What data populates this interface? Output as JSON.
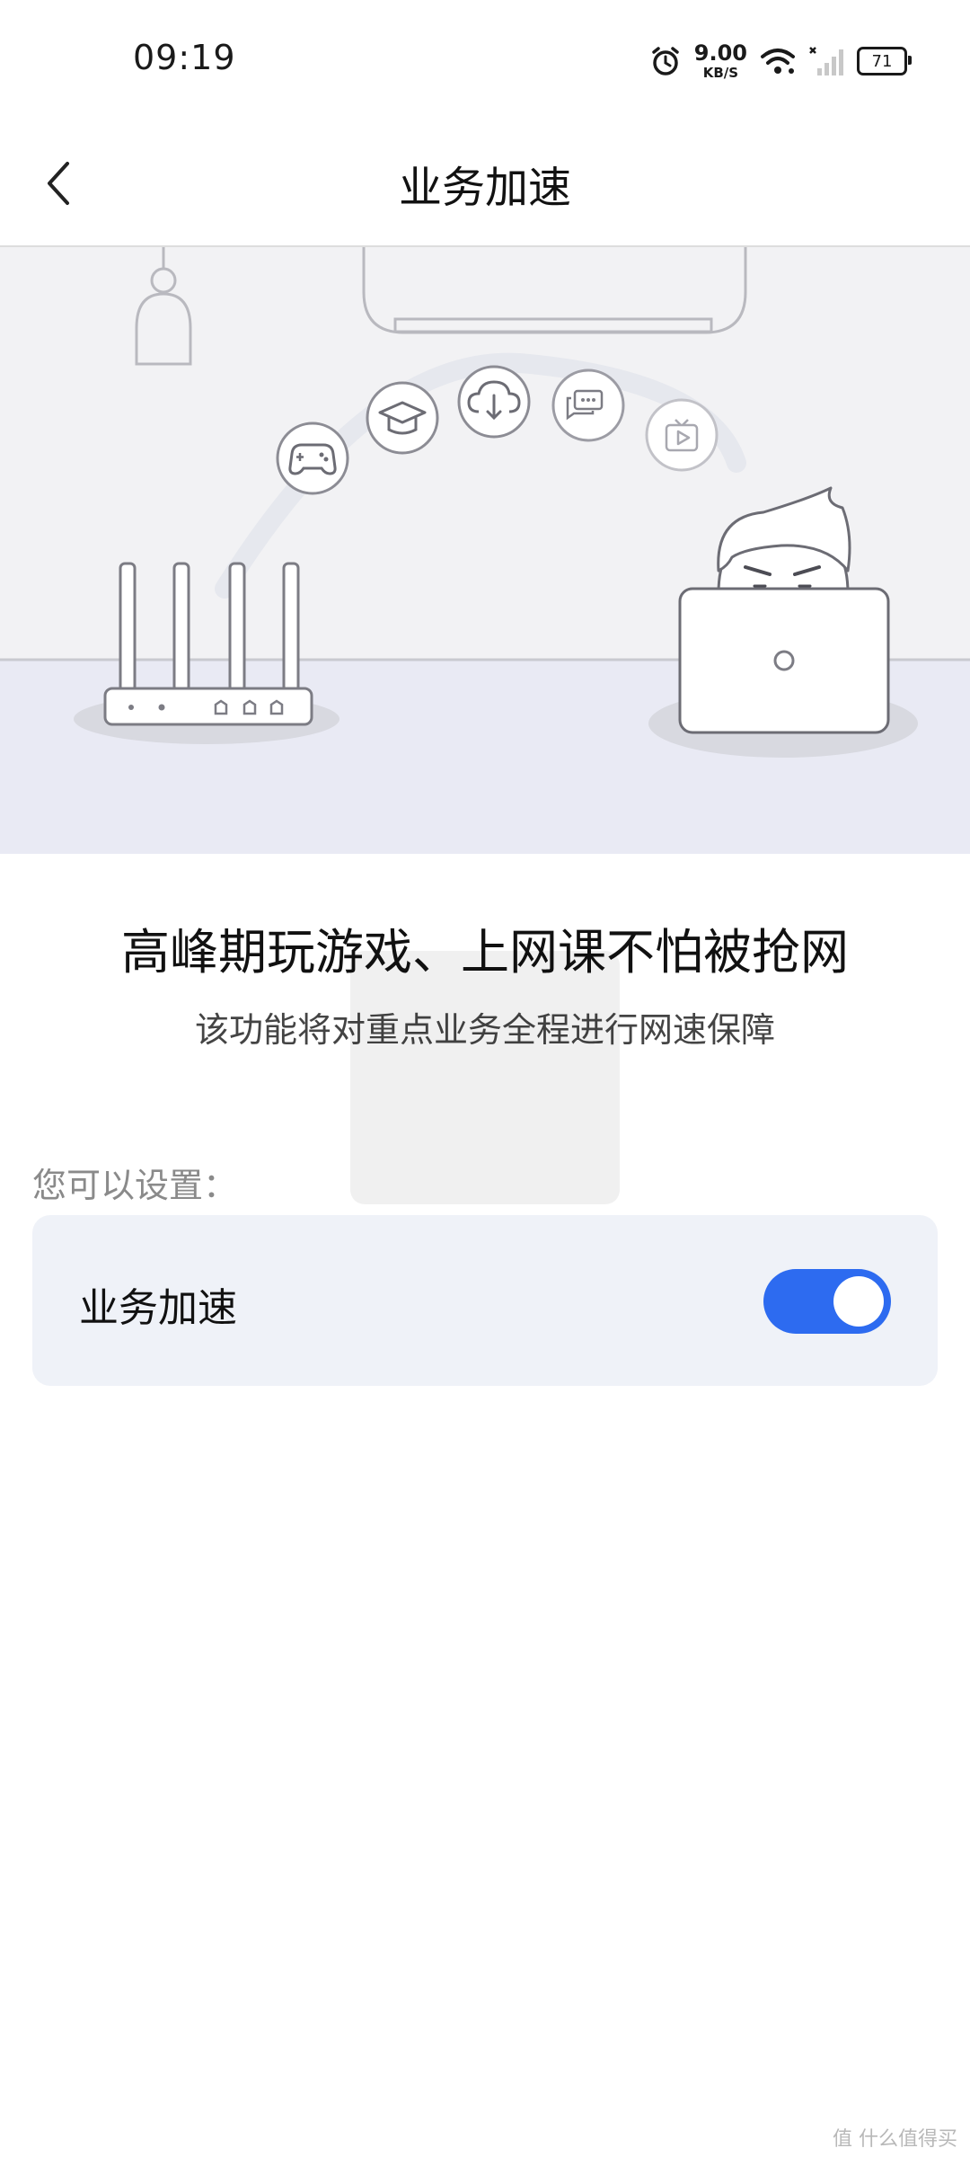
{
  "status_bar": {
    "time": "09:19",
    "net_speed": "9.00",
    "net_speed_unit": "KB/S",
    "battery": "71"
  },
  "header": {
    "title": "业务加速"
  },
  "hero": {
    "description_icons": [
      "game-controller-icon",
      "graduation-cap-icon",
      "cloud-download-icon",
      "chat-icon",
      "video-icon"
    ]
  },
  "content": {
    "headline": "高峰期玩游戏、上网课不怕被抢网",
    "subline": "该功能将对重点业务全程进行网速保障",
    "section_label": "您可以设置：",
    "setting": {
      "label": "业务加速",
      "enabled": true
    }
  },
  "colors": {
    "accent": "#2d6bf0",
    "card_bg": "#eff2f8",
    "hero_bg": "#f2f2f4",
    "floor": "#e9eaf4"
  },
  "watermark": "值 什么值得买"
}
